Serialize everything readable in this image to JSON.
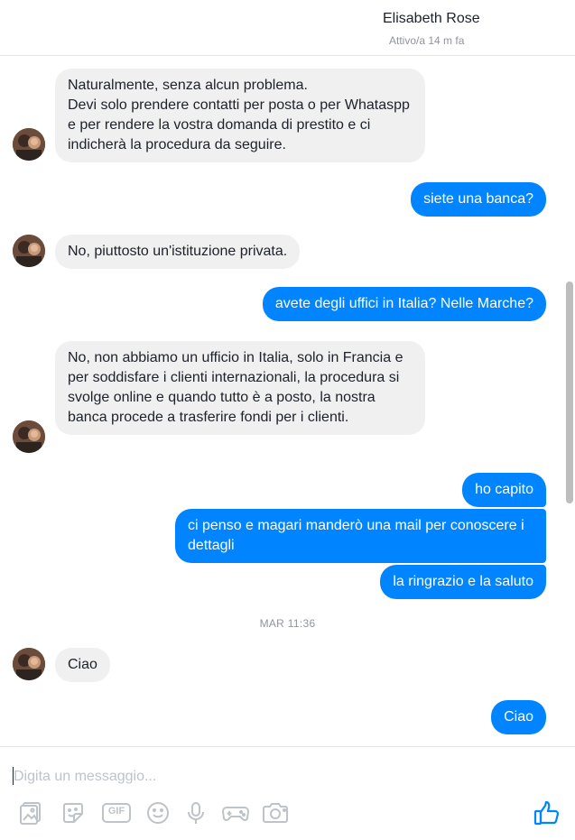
{
  "header": {
    "contact_name": "Elisabeth Rose",
    "status": "Attivo/a 14 m fa"
  },
  "messages": [
    {
      "from": "them",
      "text": "Naturalmente, senza alcun problema.\nDevi solo prendere contatti per posta o per Whataspp e per rendere la vostra domanda di prestito e ci indicherà la procedura da seguire."
    },
    {
      "from": "me",
      "text": "siete una banca?"
    },
    {
      "from": "them",
      "text": "No, piuttosto un'istituzione privata."
    },
    {
      "from": "me",
      "text": "avete degli uffici in Italia? Nelle Marche?"
    },
    {
      "from": "them",
      "text": "No, non abbiamo un ufficio in Italia, solo in Francia e per soddisfare i clienti internazionali, la procedura si svolge online e quando tutto è a posto, la nostra banca procede a trasferire fondi per i clienti."
    },
    {
      "from": "me",
      "text": "ho capito"
    },
    {
      "from": "me",
      "text": "ci penso e magari manderò una mail per conoscere i dettagli"
    },
    {
      "from": "me",
      "text": "la ringrazio e la saluto"
    },
    {
      "from": "them",
      "text": "Ciao"
    },
    {
      "from": "me",
      "text": "Ciao"
    }
  ],
  "time_separator": "MAR 11:36",
  "composer": {
    "placeholder": "Digita un messaggio...",
    "tools": [
      "photo-icon",
      "sticker-icon",
      "gif-icon",
      "emoji-icon",
      "microphone-icon",
      "game-controller-icon",
      "camera-icon"
    ],
    "gif_label": "GIF"
  },
  "like_icon": "thumbs-up-icon",
  "colors": {
    "accent": "#0084ff",
    "incoming_bubble": "#f1f0f0",
    "icon_gray": "#bec3c9"
  }
}
